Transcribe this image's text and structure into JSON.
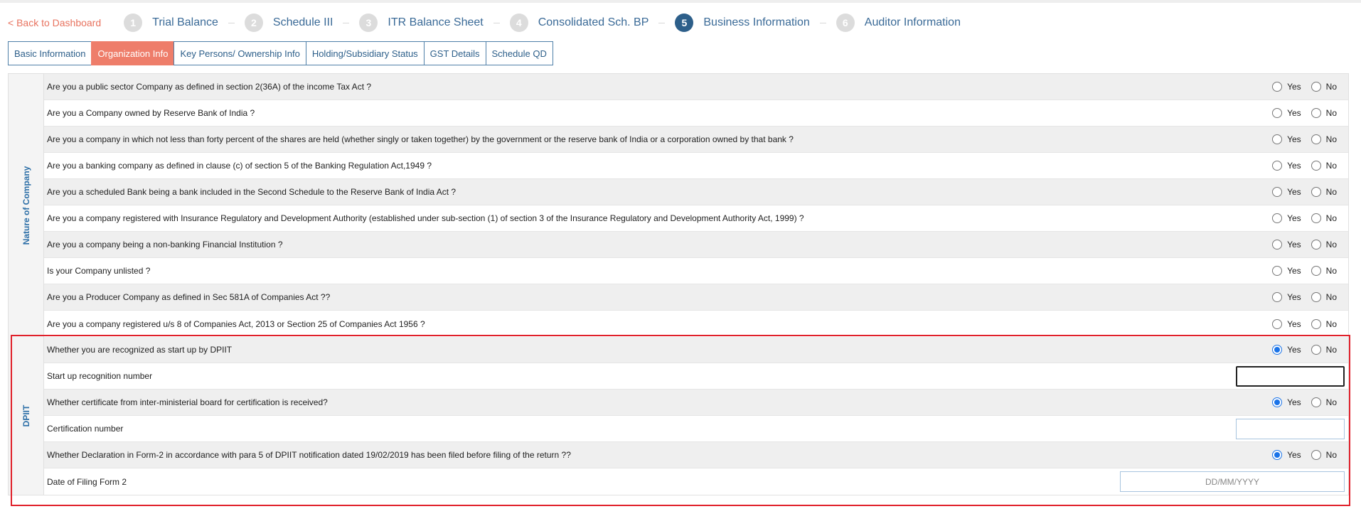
{
  "nav": {
    "back_label": "< Back to Dashboard",
    "steps": [
      {
        "num": "1",
        "label": "Trial Balance"
      },
      {
        "num": "2",
        "label": "Schedule III"
      },
      {
        "num": "3",
        "label": "ITR Balance Sheet"
      },
      {
        "num": "4",
        "label": "Consolidated Sch. BP"
      },
      {
        "num": "5",
        "label": "Business Information"
      },
      {
        "num": "6",
        "label": "Auditor Information"
      }
    ]
  },
  "tabs": [
    {
      "label": "Basic Information"
    },
    {
      "label": "Organization Info"
    },
    {
      "label": "Key Persons/ Ownership Info"
    },
    {
      "label": "Holding/Subsidiary Status"
    },
    {
      "label": "GST Details"
    },
    {
      "label": "Schedule QD"
    }
  ],
  "radio_labels": {
    "yes": "Yes",
    "no": "No"
  },
  "nature_section": {
    "title": "Nature of Company",
    "questions": [
      {
        "text": "Are you a public sector Company as defined in section 2(36A) of the income Tax Act ?",
        "answer": ""
      },
      {
        "text": "Are you a Company owned by Reserve Bank of India ?",
        "answer": ""
      },
      {
        "text": "Are you a company in which not less than forty percent of the shares are held (whether singly or taken together) by the government or the reserve bank of India or a corporation owned by that bank ?",
        "answer": ""
      },
      {
        "text": "Are you a banking company as defined in clause (c) of section 5 of the Banking Regulation Act,1949 ?",
        "answer": ""
      },
      {
        "text": "Are you a scheduled Bank being a bank included in the Second Schedule to the Reserve Bank of India Act ?",
        "answer": ""
      },
      {
        "text": "Are you a company registered with Insurance Regulatory and Development Authority (established under sub-section (1) of section 3 of the Insurance Regulatory and Development Authority Act, 1999) ?",
        "answer": ""
      },
      {
        "text": "Are you a company being a non-banking Financial Institution ?",
        "answer": ""
      },
      {
        "text": "Is your Company unlisted ?",
        "answer": ""
      },
      {
        "text": "Are you a Producer Company as defined in Sec 581A of Companies Act ??",
        "answer": ""
      },
      {
        "text": "Are you a company registered u/s 8 of Companies Act, 2013 or Section 25 of Companies Act 1956 ?",
        "answer": ""
      }
    ]
  },
  "dpiit_section": {
    "title": "DPIIT",
    "startup_question": {
      "text": "Whether you are recognized as start up by DPIIT",
      "answer": "Yes"
    },
    "recognition_number": {
      "label": "Start up recognition number",
      "value": ""
    },
    "certificate_question": {
      "text": "Whether certificate from inter-ministerial board for certification is received?",
      "answer": "Yes"
    },
    "certification_number": {
      "label": "Certification number",
      "value": ""
    },
    "form2_question": {
      "text": "Whether Declaration in Form-2 in accordance with para 5 of DPIIT notification dated 19/02/2019 has been filed before filing of the return ??",
      "answer": "Yes"
    },
    "form2_date": {
      "label": "Date of Filing Form 2",
      "placeholder": "DD/MM/YYYY",
      "value": ""
    }
  },
  "colors": {
    "primary": "#2d5f8a",
    "accent": "#ee7d6a",
    "highlight": "#e0202a",
    "radio_checked": "#1a73e8"
  }
}
